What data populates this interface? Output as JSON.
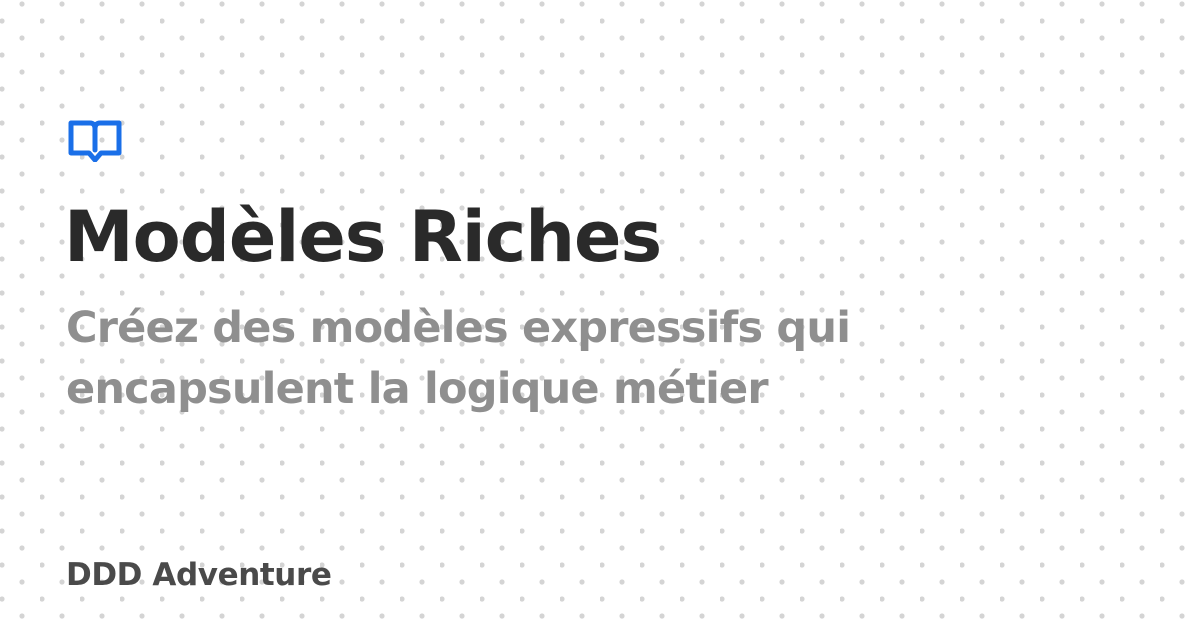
{
  "card": {
    "title": "Modèles Riches",
    "subtitle_lines": [
      "Créez des modèles expressifs qui",
      "encapsulent la logique métier"
    ],
    "site_name": "DDD Adventure"
  },
  "icons": {
    "brand": "open-book-icon"
  },
  "colors": {
    "background": "#ffffff",
    "accent": "#1a6fe8",
    "title": "#2a2a2a",
    "subtitle": "#8f8f8f",
    "site_name": "#4a4a4a",
    "dots": "#d4d4d4"
  }
}
